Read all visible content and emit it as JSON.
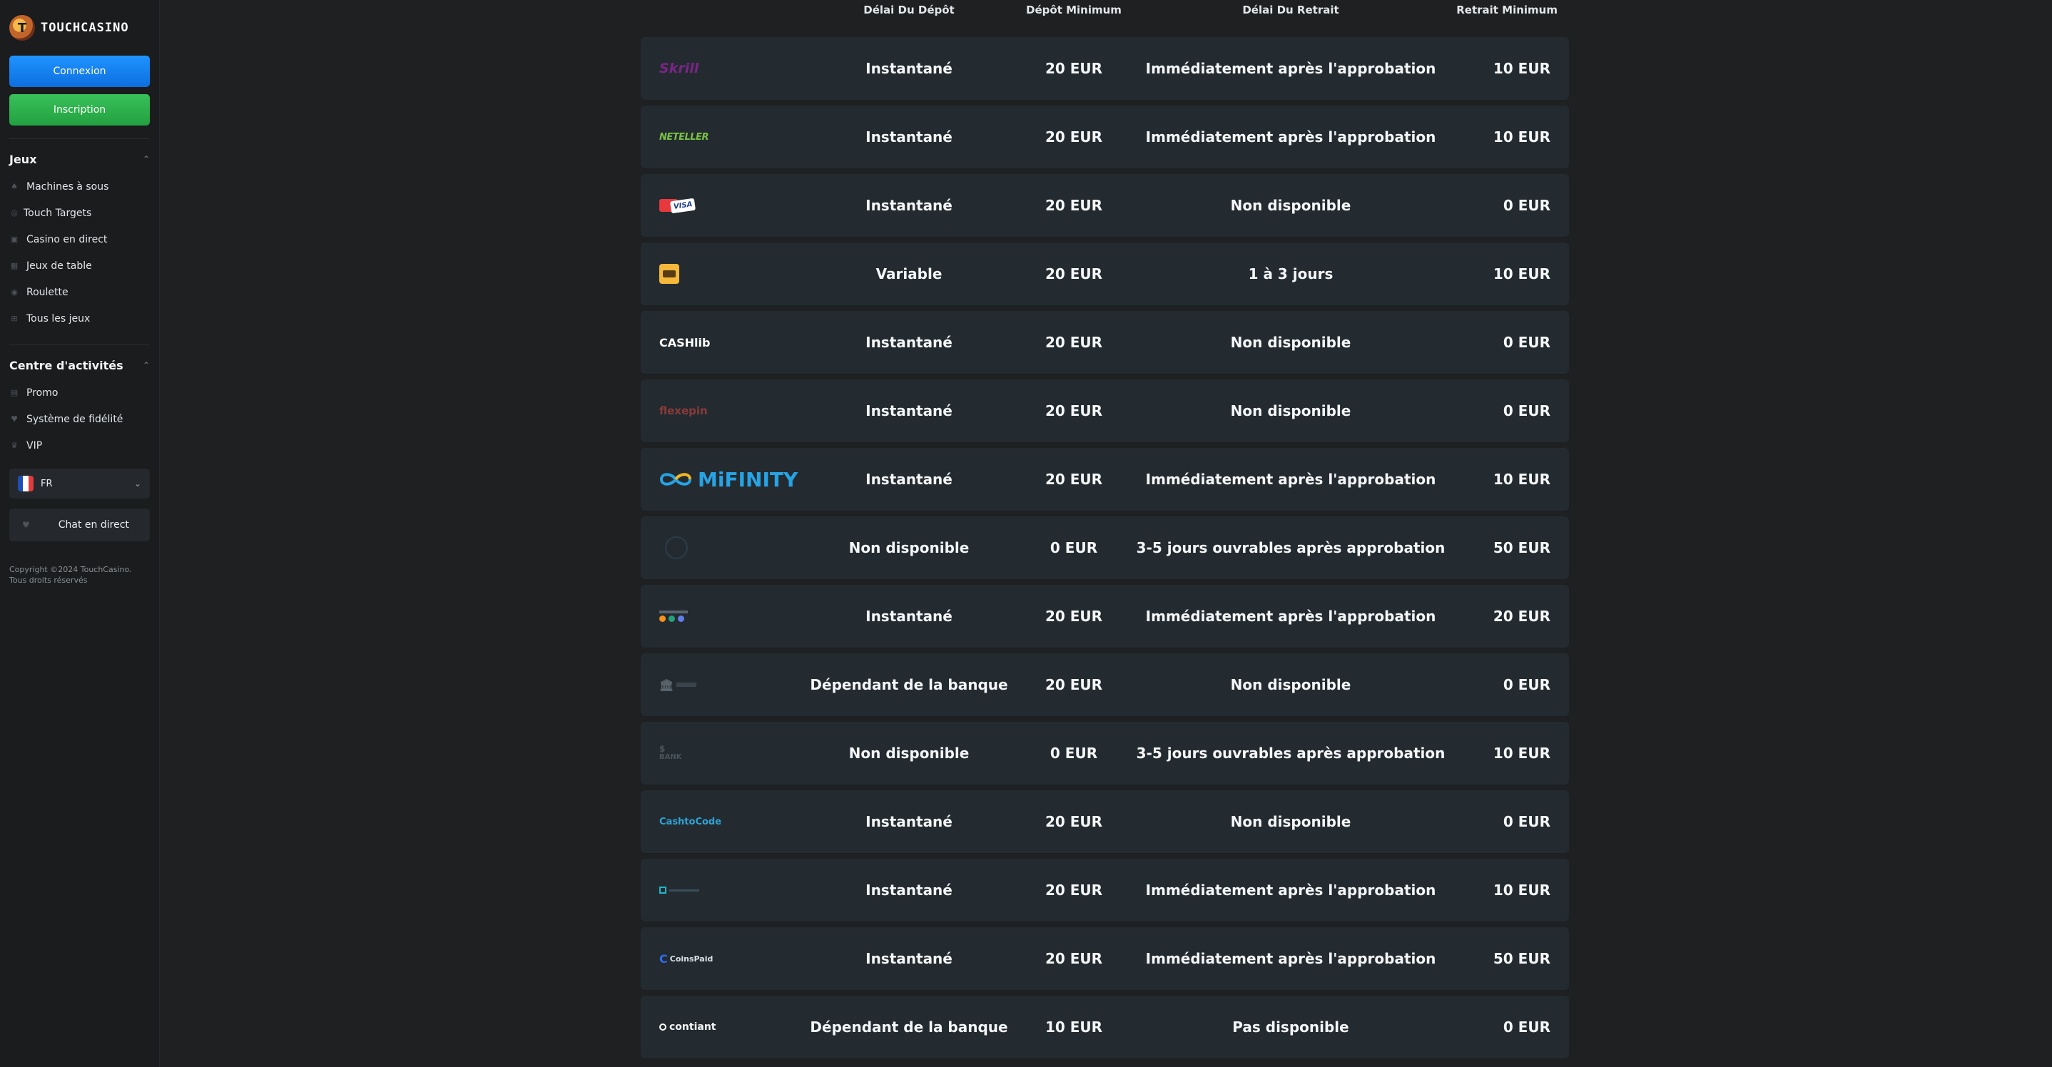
{
  "brand": {
    "name": "TOUCHCASINO"
  },
  "auth": {
    "login_label": "Connexion",
    "signup_label": "Inscription"
  },
  "games": {
    "heading": "Jeux",
    "items": [
      {
        "label": "Machines à sous",
        "icon": "slot-icon"
      },
      {
        "label": "Touch Targets",
        "icon": "target-icon"
      },
      {
        "label": "Casino en direct",
        "icon": "live-icon"
      },
      {
        "label": "Jeux de table",
        "icon": "table-icon"
      },
      {
        "label": "Roulette",
        "icon": "roulette-icon"
      },
      {
        "label": "Tous les jeux",
        "icon": "grid-icon"
      }
    ]
  },
  "activity": {
    "heading": "Centre d'activités",
    "items": [
      {
        "label": "Promo",
        "icon": "gift-icon"
      },
      {
        "label": "Système de fidélité",
        "icon": "heart-icon"
      },
      {
        "label": "VIP",
        "icon": "crown-icon"
      }
    ]
  },
  "language": {
    "code": "FR"
  },
  "chat": {
    "label": "Chat en direct"
  },
  "footer": {
    "line1": "Copyright ©2024 TouchCasino.",
    "line2": "Tous droits réservés"
  },
  "table": {
    "headers": [
      "Délai Du Dépôt",
      "Dépôt Minimum",
      "Délai Du Retrait",
      "Retrait Minimum"
    ],
    "rows": [
      {
        "logo": "Skrill",
        "deposit_time": "Instantané",
        "min_deposit": "20 EUR",
        "withdraw_time": "Immédiatement après l'approbation",
        "min_withdraw": "10 EUR"
      },
      {
        "logo": "NETELLER",
        "deposit_time": "Instantané",
        "min_deposit": "20 EUR",
        "withdraw_time": "Immédiatement après l'approbation",
        "min_withdraw": "10 EUR"
      },
      {
        "logo": "VISA",
        "deposit_time": "Instantané",
        "min_deposit": "20 EUR",
        "withdraw_time": "Non disponible",
        "min_withdraw": "0 EUR"
      },
      {
        "logo": "",
        "deposit_time": "Variable",
        "min_deposit": "20 EUR",
        "withdraw_time": "1 à 3 jours",
        "min_withdraw": "10 EUR"
      },
      {
        "logo": "CASHlib",
        "deposit_time": "Instantané",
        "min_deposit": "20 EUR",
        "withdraw_time": "Non disponible",
        "min_withdraw": "0 EUR"
      },
      {
        "logo": "flexepin",
        "deposit_time": "Instantané",
        "min_deposit": "20 EUR",
        "withdraw_time": "Non disponible",
        "min_withdraw": "0 EUR"
      },
      {
        "logo": "MiFINITY",
        "deposit_time": "Instantané",
        "min_deposit": "20 EUR",
        "withdraw_time": "Immédiatement après l'approbation",
        "min_withdraw": "10 EUR"
      },
      {
        "logo": "",
        "deposit_time": "Non disponible",
        "min_deposit": "0 EUR",
        "withdraw_time": "3-5 jours ouvrables après approbation",
        "min_withdraw": "50 EUR"
      },
      {
        "logo": "",
        "deposit_time": "Instantané",
        "min_deposit": "20 EUR",
        "withdraw_time": "Immédiatement après l'approbation",
        "min_withdraw": "20 EUR"
      },
      {
        "logo": "",
        "deposit_time": "Dépendant de la banque",
        "min_deposit": "20 EUR",
        "withdraw_time": "Non disponible",
        "min_withdraw": "0 EUR"
      },
      {
        "logo": "BANK",
        "deposit_time": "Non disponible",
        "min_deposit": "0 EUR",
        "withdraw_time": "3-5 jours ouvrables après approbation",
        "min_withdraw": "10 EUR"
      },
      {
        "logo": "CashtoCode",
        "deposit_time": "Instantané",
        "min_deposit": "20 EUR",
        "withdraw_time": "Non disponible",
        "min_withdraw": "0 EUR"
      },
      {
        "logo": "",
        "deposit_time": "Instantané",
        "min_deposit": "20 EUR",
        "withdraw_time": "Immédiatement après l'approbation",
        "min_withdraw": "10 EUR"
      },
      {
        "logo": "CoinsPaid",
        "deposit_time": "Instantané",
        "min_deposit": "20 EUR",
        "withdraw_time": "Immédiatement après l'approbation",
        "min_withdraw": "50 EUR"
      },
      {
        "logo": "contiant",
        "deposit_time": "Dépendant de la banque",
        "min_deposit": "10 EUR",
        "withdraw_time": "Pas disponible",
        "min_withdraw": "0 EUR"
      }
    ]
  }
}
